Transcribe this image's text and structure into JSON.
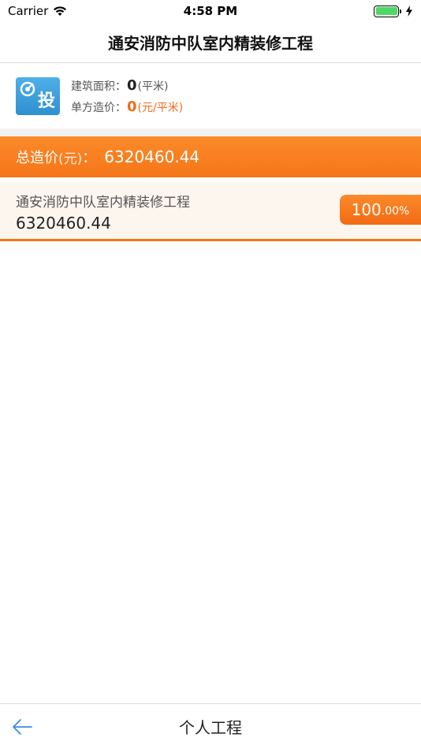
{
  "status_bar": {
    "carrier": "Carrier",
    "time": "4:58 PM",
    "icons": [
      "wifi-icon",
      "battery-icon",
      "charging-icon"
    ]
  },
  "nav": {
    "title": "通安消防中队室内精装修工程"
  },
  "info": {
    "icon_char": "投",
    "area_label": "建筑面积：",
    "area_value": "0",
    "area_unit": "(平米)",
    "price_label": "单方造价：",
    "price_value": "0",
    "price_unit": "(元/平米)"
  },
  "total": {
    "label": "总造价",
    "unit": "(元)",
    "colon": "：",
    "value": "6320460.44"
  },
  "project": {
    "name": "通安消防中队室内精装修工程",
    "value": "6320460.44",
    "percent_main": "100",
    "percent_small": ".00%"
  },
  "bottom": {
    "title": "个人工程"
  },
  "colors": {
    "accent": "#f57618",
    "icon_blue": "#3a9edb",
    "price_text": "#f26a1b",
    "battery": "#4cd964"
  }
}
